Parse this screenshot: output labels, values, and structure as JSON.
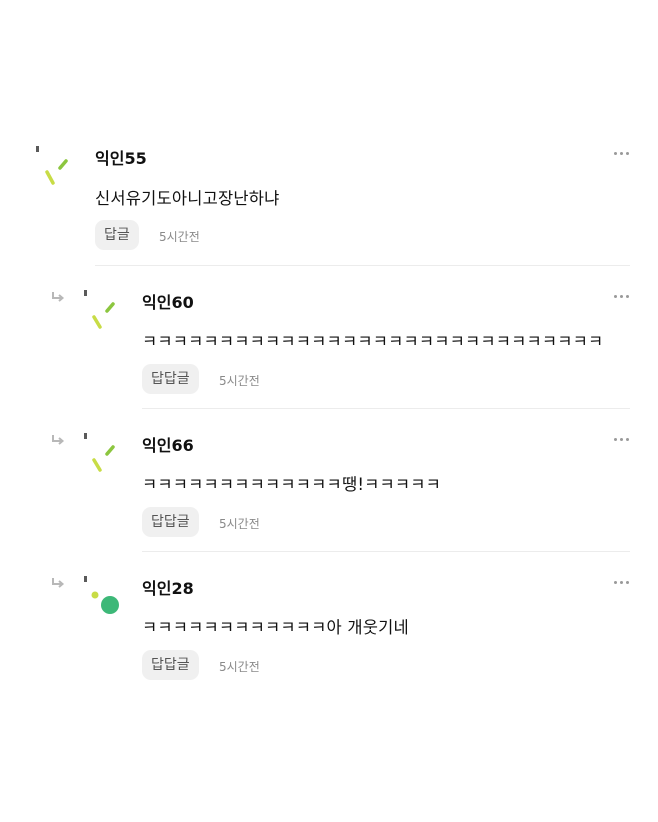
{
  "comments": [
    {
      "author": "익인55",
      "text": "신서유기도아니고장난하냐",
      "reply_label": "답글",
      "time": "5시간전",
      "avatar": "green-slash-marks",
      "is_reply": false
    },
    {
      "author": "익인60",
      "text": "ㅋㅋㅋㅋㅋㅋㅋㅋㅋㅋㅋㅋㅋㅋㅋㅋㅋㅋㅋㅋㅋㅋㅋㅋㅋㅋㅋㅋㅋㅋ",
      "reply_label": "답답글",
      "time": "5시간전",
      "avatar": "green-slash-marks",
      "is_reply": true
    },
    {
      "author": "익인66",
      "text": "ㅋㅋㅋㅋㅋㅋㅋㅋㅋㅋㅋㅋㅋ땡!ㅋㅋㅋㅋㅋ",
      "reply_label": "답답글",
      "time": "5시간전",
      "avatar": "green-slash-marks",
      "is_reply": true
    },
    {
      "author": "익인28",
      "text": "ㅋㅋㅋㅋㅋㅋㅋㅋㅋㅋㅋㅋ아 개웃기네",
      "reply_label": "답답글",
      "time": "5시간전",
      "avatar": "green-dots",
      "is_reply": true
    }
  ],
  "colors": {
    "avatar_yellow_green": "#c8dc46",
    "avatar_green": "#8cc63f",
    "avatar_teal_green": "#3db878",
    "button_bg": "#f0f0f0",
    "divider": "#ececec"
  },
  "icons": {
    "reply": "reply-arrow-icon",
    "more": "more-dots-icon"
  }
}
